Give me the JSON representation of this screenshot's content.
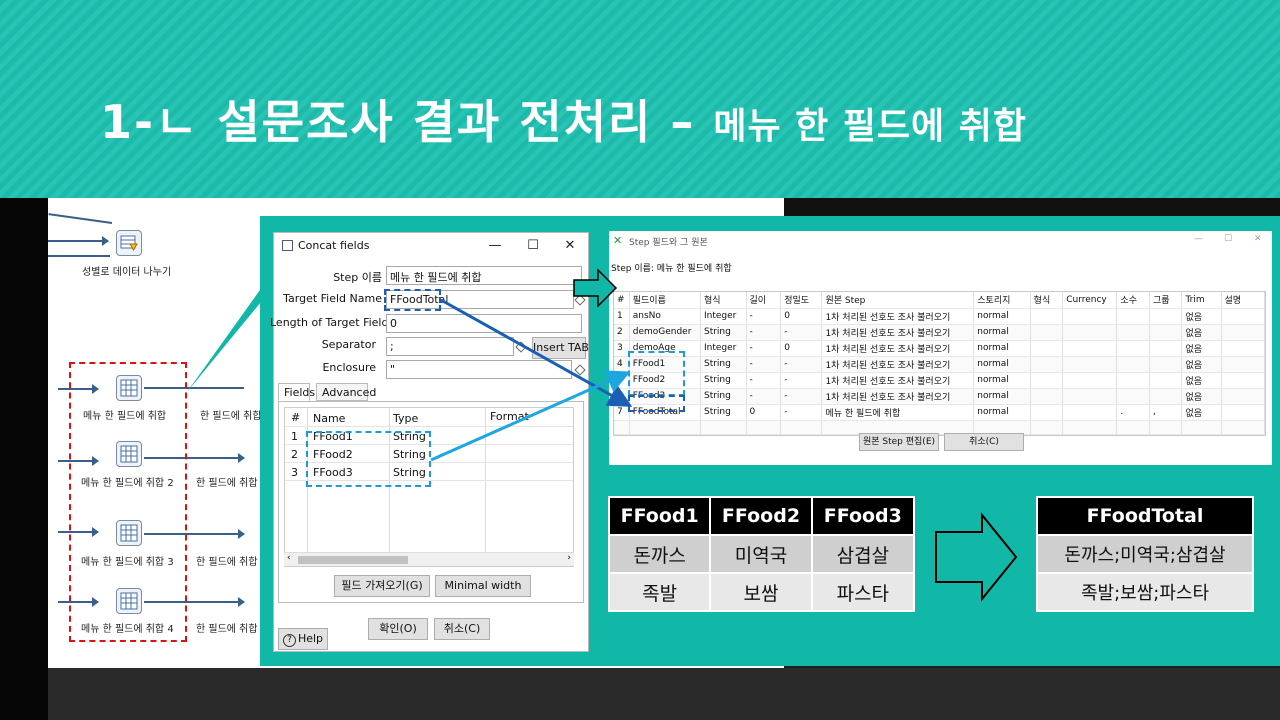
{
  "slide": {
    "title": "1-ㄴ 설문조사 결과 전처리 –",
    "subtitle": "메뉴 한 필드에 취합"
  },
  "canvas": {
    "top_step_label": "성별로 데이터 나누기",
    "steps": [
      {
        "label": "메뉴 한 필드에 취합",
        "next_label": "한 필드에 취합"
      },
      {
        "label": "메뉴 한 필드에 취합 2",
        "next_label": "한 필드에 취합"
      },
      {
        "label": "메뉴 한 필드에 취합 3",
        "next_label": "한 필드에 취합"
      },
      {
        "label": "메뉴 한 필드에 취합 4",
        "next_label": "한 필드에 취합"
      }
    ]
  },
  "concat_dialog": {
    "title": "Concat fields",
    "step_name_label": "Step 이름",
    "step_name_value": "메뉴 한 필드에 취합",
    "target_field_label": "Target Field Name",
    "target_field_value": "FFoodTotal",
    "length_label": "Length of Target Field",
    "length_value": "0",
    "separator_label": "Separator",
    "separator_value": ";",
    "insert_tab_label": "Insert TAB",
    "enclosure_label": "Enclosure",
    "enclosure_value": "\"",
    "tabs": [
      "Fields",
      "Advanced"
    ],
    "grid_headers": [
      "#",
      "Name",
      "Type",
      "Format"
    ],
    "grid_rows": [
      {
        "num": "1",
        "name": "FFood1",
        "type": "String"
      },
      {
        "num": "2",
        "name": "FFood2",
        "type": "String"
      },
      {
        "num": "3",
        "name": "FFood3",
        "type": "String"
      }
    ],
    "get_fields_label": "필드 가져오기(G)",
    "minimal_width_label": "Minimal width",
    "ok_label": "확인(O)",
    "cancel_label": "취소(C)",
    "help_label": "Help"
  },
  "fields_window": {
    "title": "Step 필드와 그 원본",
    "step_name_caption": "Step 이름:  메뉴 한 필드에 취합",
    "headers": [
      "#",
      "필드이름",
      "형식",
      "길이",
      "정밀도",
      "원본 Step",
      "스토리지",
      "형식",
      "Currency",
      "소수",
      "그룹",
      "Trim",
      "설명"
    ],
    "rows": [
      [
        "1",
        "ansNo",
        "Integer",
        "-",
        "0",
        "1차 처리된 선호도 조사 불러오기",
        "normal",
        "",
        "",
        "",
        "",
        "없음",
        ""
      ],
      [
        "2",
        "demoGender",
        "String",
        "-",
        "-",
        "1차 처리된 선호도 조사 불러오기",
        "normal",
        "",
        "",
        "",
        "",
        "없음",
        ""
      ],
      [
        "3",
        "demoAge",
        "Integer",
        "-",
        "0",
        "1차 처리된 선호도 조사 불러오기",
        "normal",
        "",
        "",
        "",
        "",
        "없음",
        ""
      ],
      [
        "4",
        "FFood1",
        "String",
        "-",
        "-",
        "1차 처리된 선호도 조사 불러오기",
        "normal",
        "",
        "",
        "",
        "",
        "없음",
        ""
      ],
      [
        "5",
        "FFood2",
        "String",
        "-",
        "-",
        "1차 처리된 선호도 조사 불러오기",
        "normal",
        "",
        "",
        "",
        "",
        "없음",
        ""
      ],
      [
        "6",
        "FFood3",
        "String",
        "-",
        "-",
        "1차 처리된 선호도 조사 불러오기",
        "normal",
        "",
        "",
        "",
        "",
        "없음",
        ""
      ],
      [
        "7",
        "FFoodTotal",
        "String",
        "0",
        "-",
        "메뉴 한 필드에 취합",
        "normal",
        "",
        "",
        ".",
        ",",
        "없음",
        ""
      ]
    ],
    "edit_source_label": "원본 Step 편집(E)",
    "cancel_label": "취소(C)"
  },
  "before_table": {
    "headers": [
      "FFood1",
      "FFood2",
      "FFood3"
    ],
    "rows": [
      [
        "돈까스",
        "미역국",
        "삼겹살"
      ],
      [
        "족발",
        "보쌈",
        "파스타"
      ]
    ]
  },
  "after_table": {
    "header": "FFoodTotal",
    "rows": [
      "돈까스;미역국;삼겹살",
      "족발;보쌈;파스타"
    ]
  },
  "colors": {
    "teal": "#11b8a8",
    "dashed_blue": "#1e90d8",
    "dashed_red": "#dd1111",
    "arrow_dark_blue": "#1a5fb4"
  }
}
